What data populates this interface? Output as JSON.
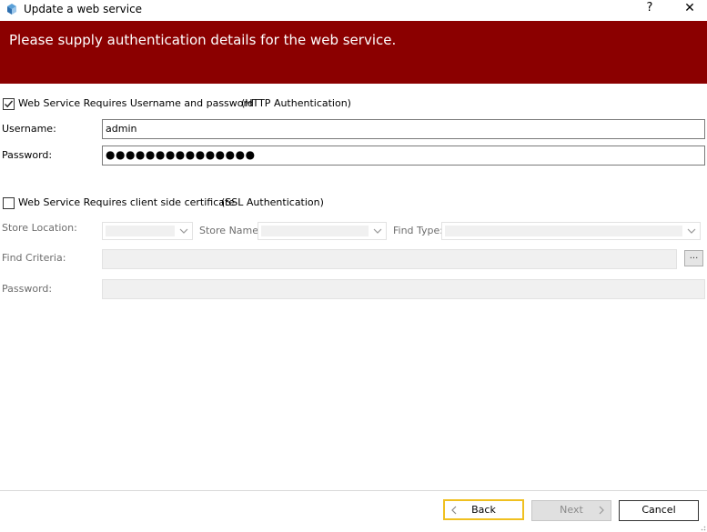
{
  "window": {
    "title": "Update a web service",
    "help_label": "?",
    "close_label": "✕"
  },
  "banner": {
    "text": "Please supply authentication details for the web service."
  },
  "http_auth": {
    "checked": true,
    "label": "Web Service Requires Username and password",
    "sublabel": "(HTTP Authentication)",
    "username_label": "Username:",
    "username_value": "admin",
    "password_label": "Password:",
    "password_value": "●●●●●●●●●●●●●●●"
  },
  "ssl_auth": {
    "checked": false,
    "label": "Web Service Requires client side certificate",
    "sublabel": "(SSL Authentication)",
    "store_location_label": "Store Location:",
    "store_name_label": "Store Name:",
    "find_type_label": "Find Type:",
    "find_criteria_label": "Find Criteria:",
    "browse_label": "...",
    "password_label": "Password:"
  },
  "footer": {
    "back_label": "Back",
    "next_label": "Next",
    "cancel_label": "Cancel"
  },
  "colors": {
    "banner": "#8b0000",
    "focus_border": "#f0c020"
  }
}
